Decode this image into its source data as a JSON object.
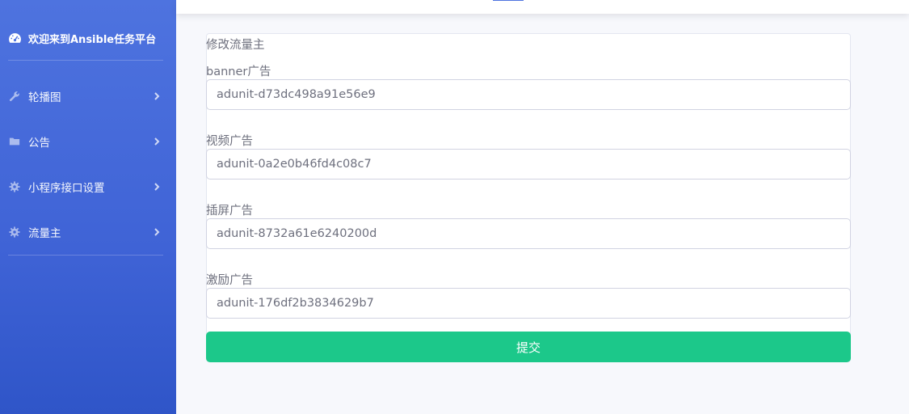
{
  "sidebar": {
    "brand": {
      "icon": "tachometer-icon",
      "title": "欢迎来到Ansible任务平台"
    },
    "items": [
      {
        "icon": "wrench-icon",
        "label": "轮播图"
      },
      {
        "icon": "folder-icon",
        "label": "公告"
      },
      {
        "icon": "cog-icon",
        "label": "小程序接口设置"
      },
      {
        "icon": "cog-icon",
        "label": "流量主"
      }
    ],
    "colors": {
      "gradient_top": "#4e73df",
      "gradient_bottom": "#2f55c8"
    }
  },
  "form": {
    "title": "修改流量主",
    "fields": [
      {
        "label": "banner广告",
        "value": "adunit-d73dc498a91e56e9"
      },
      {
        "label": "视频广告",
        "value": "adunit-0a2e0b46fd4c08c7"
      },
      {
        "label": "插屏广告",
        "value": "adunit-8732a61e6240200d"
      },
      {
        "label": "激励广告",
        "value": "adunit-176df2b3834629b7"
      }
    ],
    "submit_label": "提交",
    "submit_color": "#1cc88a"
  }
}
